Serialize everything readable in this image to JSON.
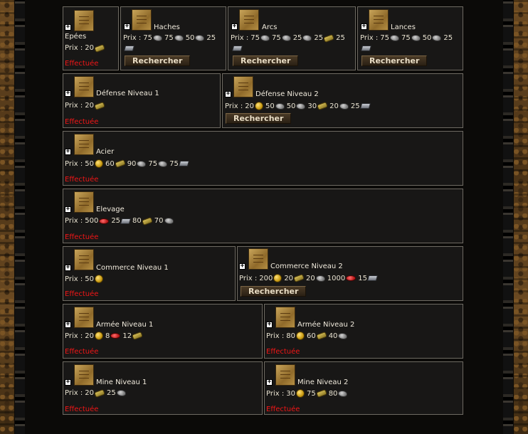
{
  "labels": {
    "price_prefix": "Prix :",
    "done": "Effectuée",
    "research": "Rechercher",
    "expand": "+"
  },
  "colors": {
    "status_done": "#f01616",
    "panel_bg": "#181716",
    "panel_border": "#6e6a62"
  },
  "techs": {
    "epees": {
      "name": "Epées",
      "price": [
        "20"
      ],
      "icons": [
        "wood-icon"
      ]
    },
    "haches": {
      "name": "Haches",
      "price": [
        "75",
        "75",
        "50",
        "25"
      ],
      "icons": [
        "stone-icon",
        "stone-icon",
        "stone-icon",
        "iron-icon"
      ]
    },
    "arcs": {
      "name": "Arcs",
      "price": [
        "75",
        "75",
        "25",
        "25",
        "25"
      ],
      "icons": [
        "stone-icon",
        "stone-icon",
        "stone-icon",
        "wood-icon",
        "iron-icon"
      ]
    },
    "lances": {
      "name": "Lances",
      "price": [
        "75",
        "75",
        "50",
        "25"
      ],
      "icons": [
        "stone-icon",
        "stone-icon",
        "stone-icon",
        "iron-icon"
      ]
    },
    "defense1": {
      "name": "Défense Niveau 1",
      "price": [
        "20"
      ],
      "icons": [
        "wood-icon"
      ]
    },
    "defense2": {
      "name": "Défense Niveau 2",
      "price": [
        "20",
        "50",
        "50",
        "30",
        "20",
        "25"
      ],
      "icons": [
        "gold-icon",
        "stone-icon",
        "stone-icon",
        "wood-icon",
        "stone-icon",
        "iron-icon"
      ]
    },
    "acier": {
      "name": "Acier",
      "price": [
        "50",
        "60",
        "90",
        "75",
        "75"
      ],
      "icons": [
        "gold-icon",
        "wood-icon",
        "stone-icon",
        "stone-icon",
        "iron-icon"
      ]
    },
    "elevage": {
      "name": "Elevage",
      "price": [
        "500",
        "25",
        "80",
        "70"
      ],
      "icons": [
        "food-icon",
        "iron-icon",
        "wood-icon",
        "stone-icon"
      ]
    },
    "commerce1": {
      "name": "Commerce Niveau 1",
      "price": [
        "50"
      ],
      "icons": [
        "gold-icon"
      ]
    },
    "commerce2": {
      "name": "Commerce Niveau 2",
      "price": [
        "200",
        "20",
        "20",
        "1000",
        "15"
      ],
      "icons": [
        "gold-icon",
        "wood-icon",
        "stone-icon",
        "food-icon",
        "iron-icon"
      ]
    },
    "armee1": {
      "name": "Armée Niveau 1",
      "price": [
        "20",
        "8",
        "12"
      ],
      "icons": [
        "gold-icon",
        "food-icon",
        "wood-icon"
      ]
    },
    "armee2": {
      "name": "Armée Niveau 2",
      "price": [
        "80",
        "60",
        "40"
      ],
      "icons": [
        "gold-icon",
        "wood-icon",
        "stone-icon"
      ]
    },
    "mine1": {
      "name": "Mine Niveau 1",
      "price": [
        "20",
        "25"
      ],
      "icons": [
        "wood-icon",
        "stone-icon"
      ]
    },
    "mine2": {
      "name": "Mine Niveau 2",
      "price": [
        "30",
        "75",
        "80"
      ],
      "icons": [
        "gold-icon",
        "wood-icon",
        "stone-icon"
      ]
    }
  }
}
